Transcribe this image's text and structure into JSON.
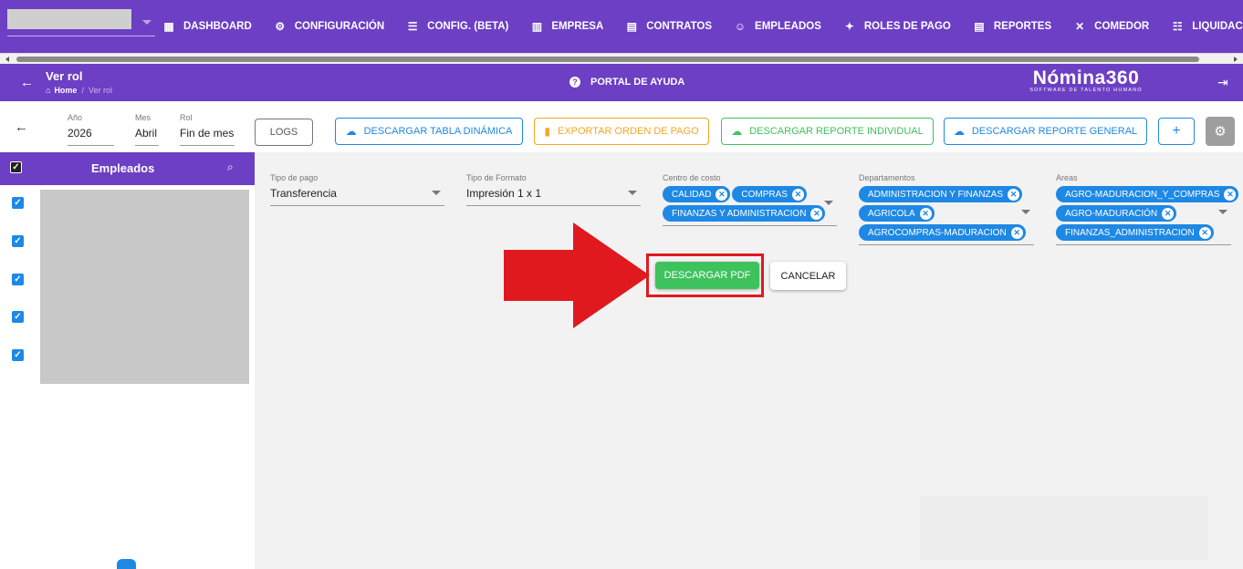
{
  "nav": {
    "items": [
      {
        "label": "DASHBOARD",
        "icon": "dashboard-icon",
        "glyph": "▦"
      },
      {
        "label": "CONFIGURACIÓN",
        "icon": "gear-icon",
        "glyph": "⚙"
      },
      {
        "label": "CONFIG. (BETA)",
        "icon": "sliders-icon",
        "glyph": "☰"
      },
      {
        "label": "EMPRESA",
        "icon": "building-icon",
        "glyph": "▥"
      },
      {
        "label": "CONTRATOS",
        "icon": "clipboard-icon",
        "glyph": "▤"
      },
      {
        "label": "EMPLEADOS",
        "icon": "face-icon",
        "glyph": "☺"
      },
      {
        "label": "ROLES DE PAGO",
        "icon": "people-icon",
        "glyph": "✦"
      },
      {
        "label": "REPORTES",
        "icon": "clipboard-list-icon",
        "glyph": "▤"
      },
      {
        "label": "COMEDOR",
        "icon": "cutlery-icon",
        "glyph": "✕"
      },
      {
        "label": "LIQUIDACIONES",
        "icon": "list-icon",
        "glyph": "☷"
      }
    ]
  },
  "header": {
    "title": "Ver rol",
    "breadcrumb_home": "Home",
    "breadcrumb_sep": "/",
    "breadcrumb_current": "Ver rol",
    "help_label": "PORTAL DE AYUDA",
    "logo_main": "Nómina360",
    "logo_sub": "SOFTWARE DE TALENTO HUMANO"
  },
  "toolbar": {
    "year_label": "Año",
    "year_value": "2026",
    "month_label": "Mes",
    "month_value": "Abril",
    "rol_label": "Rol",
    "rol_value": "Fin de mes",
    "logs_label": "LOGS",
    "pivot_label": "DESCARGAR TABLA DINÁMICA",
    "export_label": "EXPORTAR ORDEN DE PAGO",
    "individual_label": "DESCARGAR REPORTE INDIVIDUAL",
    "general_label": "DESCARGAR REPORTE GENERAL",
    "add_label": "+"
  },
  "sidebar": {
    "title": "Empleados",
    "row_count": 5
  },
  "filters": {
    "tipo_pago": {
      "label": "Tipo de pago",
      "value": "Transferencia"
    },
    "tipo_formato": {
      "label": "Tipo de Formato",
      "value": "Impresión 1 x 1"
    },
    "centro_costo": {
      "label": "Centro de costo",
      "chips": [
        "CALIDAD",
        "COMPRAS",
        "FINANZAS Y ADMINISTRACION"
      ]
    },
    "departamentos": {
      "label": "Departamentos",
      "chips": [
        "ADMINISTRACION Y FINANZAS",
        "AGRICOLA",
        "AGROCOMPRAS-MADURACION"
      ]
    },
    "areas": {
      "label": "Areas",
      "chips": [
        "AGRO-MADURACION_Y_COMPRAS",
        "AGRO-MADURACIÓN",
        "FINANZAS_ADMINISTRACION"
      ]
    }
  },
  "actions": {
    "pdf_label": "DESCARGAR PDF",
    "cancel_label": "CANCELAR"
  },
  "colors": {
    "brand": "#6c3fc4",
    "primary": "#1e88e5",
    "success": "#3ec25e",
    "warning": "#f5a623",
    "highlight": "#e0191f"
  }
}
